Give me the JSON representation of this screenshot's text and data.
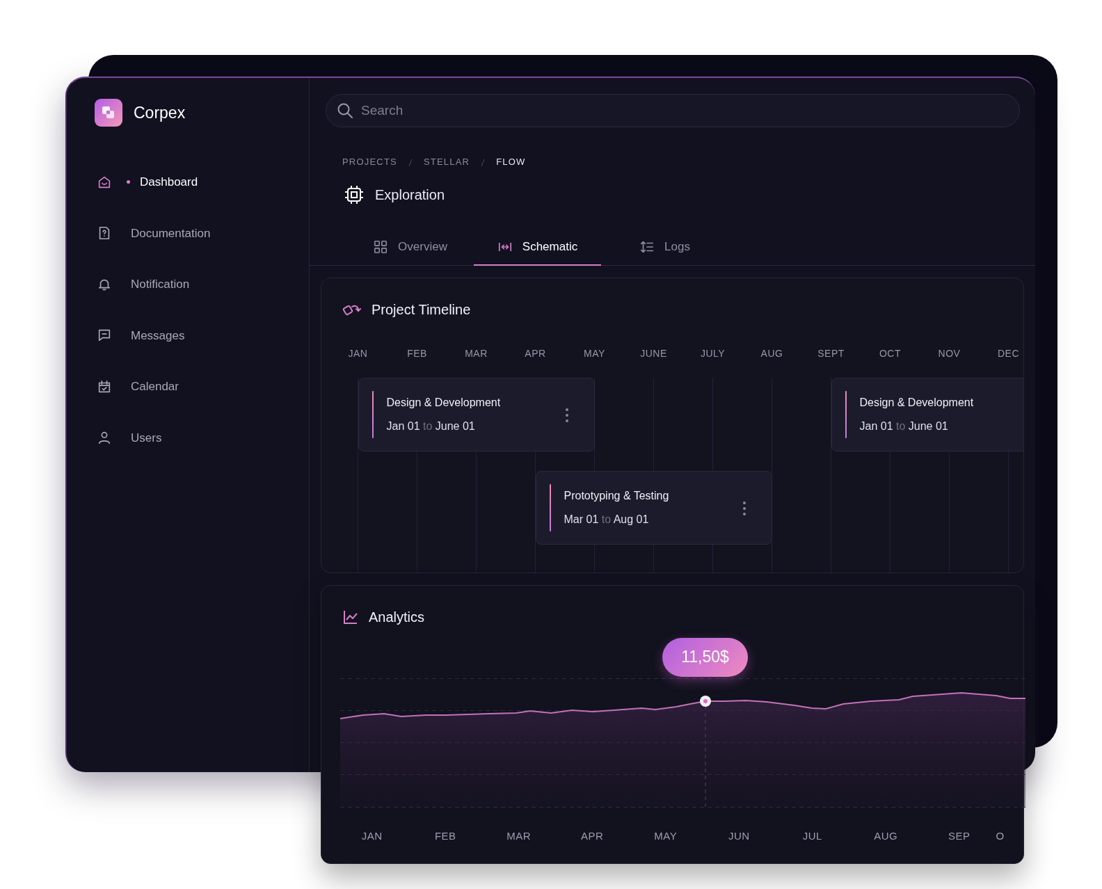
{
  "brand": {
    "name": "Corpex"
  },
  "sidebar": {
    "items": [
      {
        "label": "Dashboard",
        "selected": true
      },
      {
        "label": "Documentation",
        "selected": false
      },
      {
        "label": "Notification",
        "selected": false
      },
      {
        "label": "Messages",
        "selected": false
      },
      {
        "label": "Calendar",
        "selected": false
      },
      {
        "label": "Users",
        "selected": false
      }
    ]
  },
  "search": {
    "placeholder": "Search"
  },
  "breadcrumb": [
    "PROJECTS",
    "STELLAR",
    "FLOW"
  ],
  "page_title": "Exploration",
  "tabs": [
    {
      "label": "Overview",
      "selected": false
    },
    {
      "label": "Schematic",
      "selected": true
    },
    {
      "label": "Logs",
      "selected": false
    }
  ],
  "timeline": {
    "title": "Project Timeline",
    "months": [
      "JAN",
      "FEB",
      "MAR",
      "APR",
      "MAY",
      "JUNE",
      "JULY",
      "AUG",
      "SEPT",
      "OCT",
      "NOV",
      "DEC"
    ],
    "items": [
      {
        "title": "Design & Development",
        "from": "Jan 01",
        "joiner": "to",
        "to": "June 01"
      },
      {
        "title": "Prototyping & Testing",
        "from": "Mar 01",
        "joiner": "to",
        "to": "Aug 01"
      },
      {
        "title": "Design & Development",
        "from": "Jan 01",
        "joiner": "to",
        "to": "June 01"
      }
    ]
  },
  "analytics": {
    "title": "Analytics",
    "tooltip": "11,50$",
    "x_labels": [
      "JAN",
      "FEB",
      "MAR",
      "APR",
      "MAY",
      "JUN",
      "JUL",
      "AUG",
      "SEP",
      "O"
    ]
  }
}
